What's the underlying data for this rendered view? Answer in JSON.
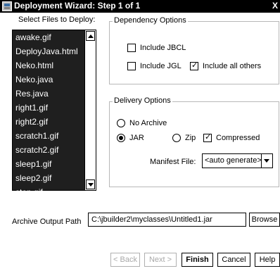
{
  "window": {
    "title": "Deployment Wizard: Step 1 of 1",
    "close_glyph": "X",
    "app_icon": "wizard-app-icon"
  },
  "files": {
    "label": "Select Files to Deploy:",
    "items": [
      "awake.gif",
      "DeployJava.html",
      "Neko.html",
      "Neko.java",
      "Res.java",
      "right1.gif",
      "right2.gif",
      "scratch1.gif",
      "scratch2.gif",
      "sleep1.gif",
      "sleep2.gif",
      "stop.gif"
    ]
  },
  "dependency_options": {
    "legend": "Dependency Options",
    "include_jbcl": {
      "label": "Include JBCL",
      "checked": false
    },
    "include_jgl": {
      "label": "Include JGL",
      "checked": false
    },
    "include_all_others": {
      "label": "Include all others",
      "checked": true
    }
  },
  "delivery_options": {
    "legend": "Delivery Options",
    "no_archive": {
      "label": "No Archive",
      "selected": false
    },
    "jar": {
      "label": "JAR",
      "selected": true
    },
    "zip": {
      "label": "Zip",
      "selected": false
    },
    "compressed": {
      "label": "Compressed",
      "checked": true
    },
    "manifest_label": "Manifest File:",
    "manifest_value": "<auto generate>"
  },
  "archive": {
    "label": "Archive Output Path",
    "value": "C:\\jbuilder2\\myclasses\\Untitled1.jar",
    "browse_label": "Browse"
  },
  "buttons": {
    "back": "< Back",
    "next": "Next >",
    "finish": "Finish",
    "cancel": "Cancel",
    "help": "Help"
  }
}
